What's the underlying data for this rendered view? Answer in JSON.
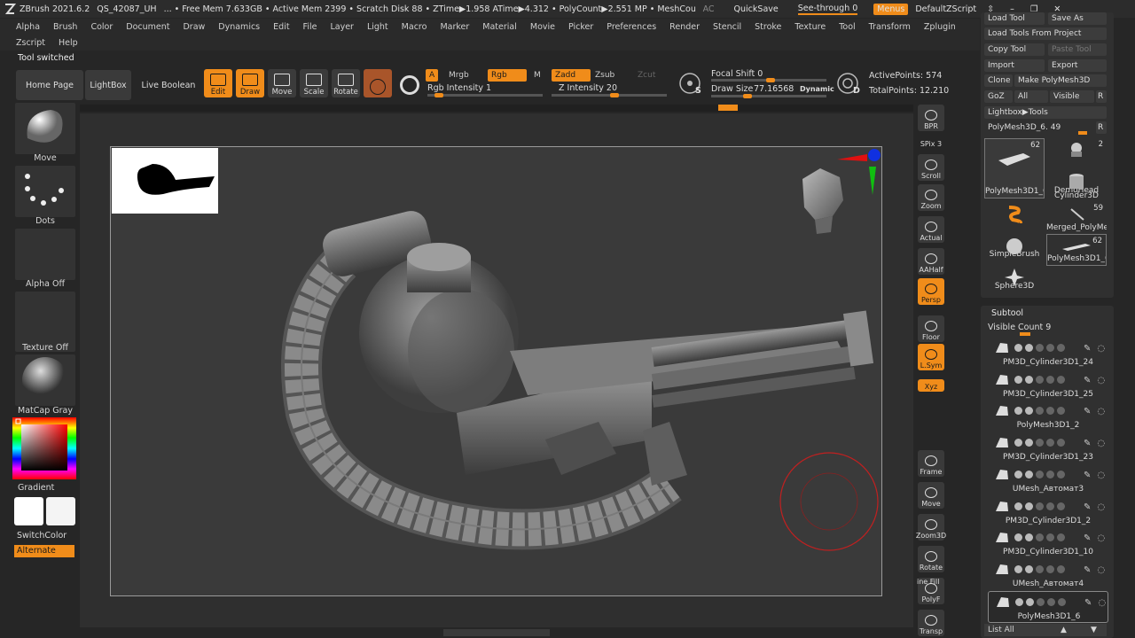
{
  "titlebar": {
    "app": "ZBrush 2021.6.2",
    "project": "QS_42087_UH",
    "stats": "... • Free Mem 7.633GB • Active Mem 2399 • Scratch Disk 88 • ZTime▶1.958 ATime▶4.312 • PolyCount▶2.551 MP • MeshCount▶",
    "ac": "AC",
    "quicksave": "QuickSave",
    "see_through": "See-through 0",
    "menus": "Menus",
    "script": "DefaultZScript"
  },
  "menubar": {
    "row1": [
      "Alpha",
      "Brush",
      "Color",
      "Document",
      "Draw",
      "Dynamics",
      "Edit",
      "File",
      "Layer",
      "Light",
      "Macro",
      "Marker",
      "Material",
      "Movie",
      "Picker",
      "Preferences",
      "Render",
      "Stencil",
      "Stroke",
      "Texture",
      "Tool",
      "Transform",
      "Zplugin"
    ],
    "row2": [
      "Zscript",
      "Help"
    ]
  },
  "status_text": "Tool switched",
  "shelf": {
    "home": "Home Page",
    "lightbox": "LightBox",
    "live_boolean": "Live Boolean",
    "edit": "Edit",
    "draw": "Draw",
    "move": "Move",
    "scale": "Scale",
    "rotate": "Rotate",
    "a": "A",
    "mrgb": "Mrgb",
    "rgb": "Rgb",
    "m": "M",
    "rgb_intensity": "Rgb Intensity 1",
    "zadd": "Zadd",
    "zsub": "Zsub",
    "zcut": "Zcut",
    "z_intensity": "Z Intensity 20",
    "focal_shift": "Focal Shift 0",
    "draw_size_label": "Draw Size",
    "draw_size_value": "77.16568",
    "dynamic": "Dynamic",
    "active_points": "ActivePoints: 574",
    "total_points": "TotalPoints: 12.210",
    "s": "S",
    "d": "D"
  },
  "left_panel": {
    "brush": "Move",
    "stroke": "Dots",
    "alpha": "Alpha Off",
    "texture": "Texture Off",
    "material": "MatCap Gray",
    "gradient": "Gradient",
    "switch_color": "SwitchColor",
    "alternate": "Alternate"
  },
  "right_shelf": [
    "BPR",
    "SPix 3",
    "Scroll",
    "Zoom",
    "Actual",
    "AAHalf",
    "Persp",
    "Floor",
    "L.Sym",
    "Xyz",
    "Frame",
    "Move",
    "Zoom3D",
    "Rotate",
    "PolyF",
    "Transp"
  ],
  "line_fill": "ine Fill",
  "tool_palette": {
    "load_tool": "Load Tool",
    "save_as": "Save As",
    "load_from_project": "Load Tools From Project",
    "copy_tool": "Copy Tool",
    "paste_tool": "Paste Tool",
    "import": "Import",
    "export": "Export",
    "clone": "Clone",
    "make_polymesh": "Make PolyMesh3D",
    "goz": "GoZ",
    "all": "All",
    "visible": "Visible",
    "r": "R",
    "lightbox_tools": "Lightbox▶Tools",
    "current_tool": "PolyMesh3D_6. 49",
    "thumbs": [
      {
        "name": "PolyMesh3D1_6",
        "count": "62"
      },
      {
        "name": "DemoHead",
        "count": "2"
      },
      {
        "name": "Cylinder3D",
        "count": ""
      },
      {
        "name": "SimpleBrush",
        "count": ""
      },
      {
        "name": "Merged_PolyMe",
        "count": "59"
      },
      {
        "name": "Sphere3D",
        "count": ""
      },
      {
        "name": "PolyMesh3D1_6",
        "count": "62"
      },
      {
        "name": "PolyMesh3D",
        "count": ""
      }
    ]
  },
  "subtool": {
    "title": "Subtool",
    "visible_count": "Visible Count 9",
    "items": [
      "PM3D_Cylinder3D1_24",
      "PM3D_Cylinder3D1_25",
      "PolyMesh3D1_2",
      "PM3D_Cylinder3D1_23",
      "UMesh_Автомат3",
      "PM3D_Cylinder3D1_2",
      "PM3D_Cylinder3D1_10",
      "UMesh_Автомат4",
      "PolyMesh3D1_6"
    ],
    "list_all": "List All"
  },
  "colors": {
    "accent": "#f08c1a",
    "background": "#262626",
    "canvas": "#3a3a3a"
  }
}
